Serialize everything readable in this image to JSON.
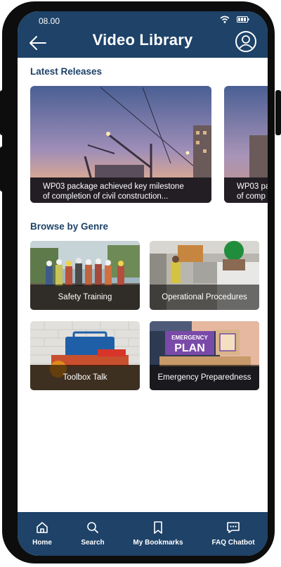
{
  "status": {
    "time": "08.00"
  },
  "header": {
    "title": "Video Library"
  },
  "latest": {
    "heading": "Latest Releases",
    "cards": [
      {
        "caption_line1": "WP03 package achieved key milestone",
        "caption_line2": "of completion of civil construction..."
      },
      {
        "caption_line1": "WP03 pa",
        "caption_line2": "of comp"
      }
    ]
  },
  "genres": {
    "heading": "Browse by Genre",
    "items": [
      {
        "label": "Safety Training"
      },
      {
        "label": "Operational Procedures"
      },
      {
        "label": "Toolbox Talk"
      },
      {
        "label": "Emergency Preparedness"
      }
    ]
  },
  "plan_art": {
    "line1": "EMERGENCY",
    "line2": "PLAN"
  },
  "nav": {
    "items": [
      {
        "label": "Home",
        "icon": "home-icon"
      },
      {
        "label": "Search",
        "icon": "search-icon"
      },
      {
        "label": "My Bookmarks",
        "icon": "bookmark-icon"
      },
      {
        "label": "FAQ Chatbot",
        "icon": "chat-icon"
      }
    ]
  },
  "colors": {
    "primary": "#1e4268",
    "background": "#ffffff"
  }
}
